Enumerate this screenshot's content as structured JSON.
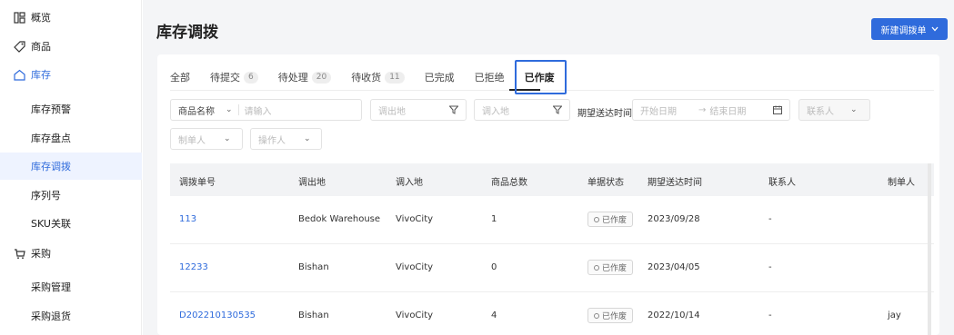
{
  "sidebar": {
    "items": [
      {
        "label": "概览",
        "icon": "grid-icon"
      },
      {
        "label": "商品",
        "icon": "tag-icon"
      },
      {
        "label": "库存",
        "icon": "house-icon"
      },
      {
        "label": "库存预警"
      },
      {
        "label": "库存盘点"
      },
      {
        "label": "库存调拨"
      },
      {
        "label": "序列号"
      },
      {
        "label": "SKU关联"
      },
      {
        "label": "采购",
        "icon": "cart-icon"
      },
      {
        "label": "采购管理"
      },
      {
        "label": "采购退货"
      }
    ],
    "active_item": "库存调拨"
  },
  "header": {
    "title": "库存调拨",
    "primary_button": "新建调拨单"
  },
  "tabs": [
    {
      "label": "全部",
      "count": ""
    },
    {
      "label": "待提交",
      "count": "6"
    },
    {
      "label": "待处理",
      "count": "20"
    },
    {
      "label": "待收货",
      "count": "11"
    },
    {
      "label": "已完成",
      "count": ""
    },
    {
      "label": "已拒绝",
      "count": ""
    },
    {
      "label": "已作废",
      "count": ""
    }
  ],
  "active_tab": "已作废",
  "filters": {
    "product_select": "商品名称",
    "product_placeholder": "请输入",
    "from_placeholder": "调出地",
    "to_placeholder": "调入地",
    "date_label": "期望送达时间",
    "start_date_placeholder": "开始日期",
    "date_separator": "→",
    "end_date_placeholder": "结束日期",
    "contact_placeholder": "联系人",
    "creator_placeholder": "制单人",
    "operator_placeholder": "操作人"
  },
  "table": {
    "columns": [
      "调拨单号",
      "调出地",
      "调入地",
      "商品总数",
      "单据状态",
      "期望送达时间",
      "联系人",
      "制单人"
    ],
    "rows": [
      {
        "id": "113",
        "from": "Bedok Warehouse",
        "to": "VivoCity",
        "qty": "1",
        "status": "已作废",
        "date": "2023/09/28",
        "contact": "-",
        "creator": ""
      },
      {
        "id": "12233",
        "from": "Bishan",
        "to": "VivoCity",
        "qty": "0",
        "status": "已作废",
        "date": "2023/04/05",
        "contact": "-",
        "creator": ""
      },
      {
        "id": "D202210130535",
        "from": "Bishan",
        "to": "VivoCity",
        "qty": "4",
        "status": "已作废",
        "date": "2022/10/14",
        "contact": "-",
        "creator": "jay"
      }
    ]
  },
  "colors": {
    "accent": "#2f6bdc",
    "active_bg": "#eef3ff",
    "page_bg": "#f4f5f7"
  }
}
